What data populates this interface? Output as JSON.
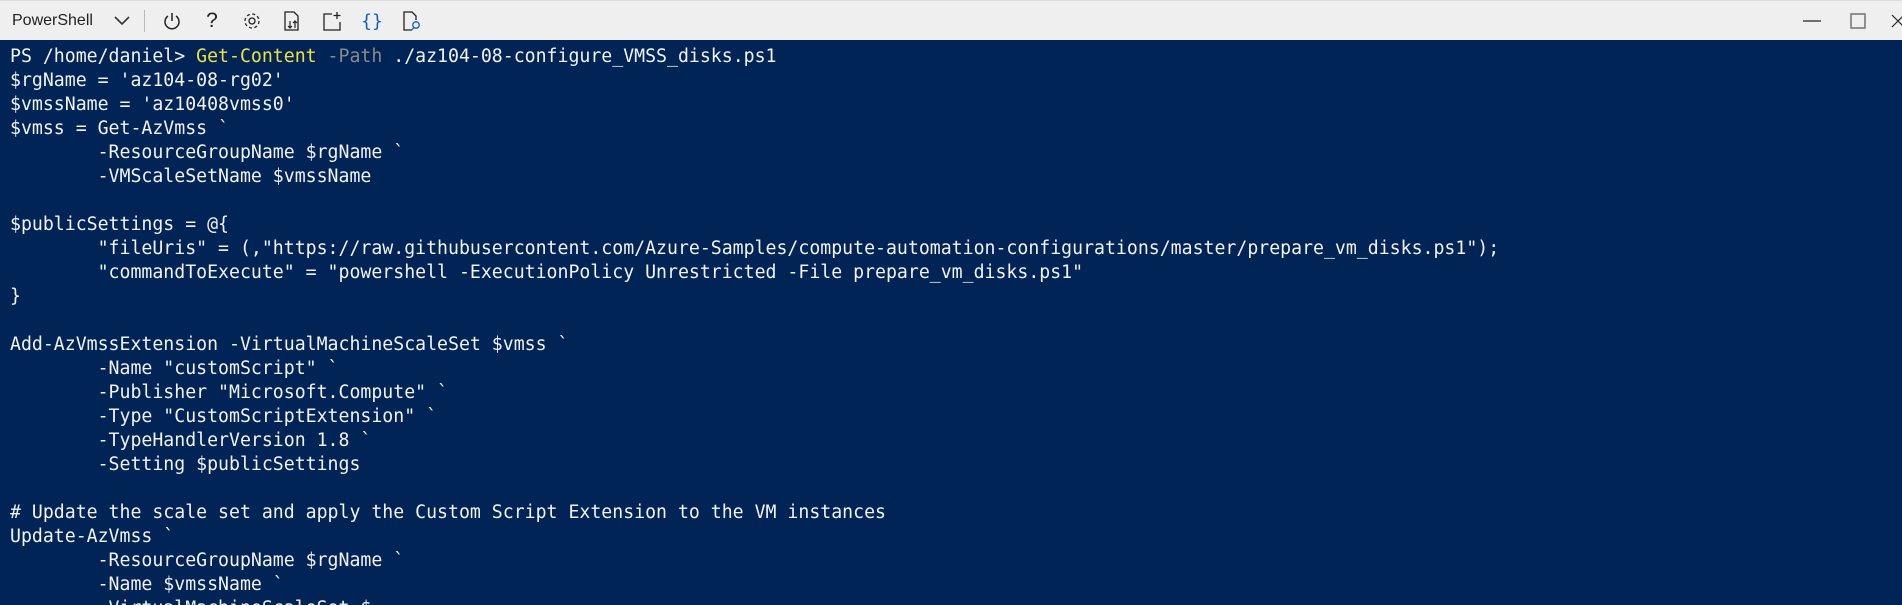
{
  "toolbar": {
    "shell_selector": "PowerShell",
    "icons": [
      "chevron-down-icon",
      "power-icon",
      "help-icon",
      "gear-icon",
      "upload-download-icon",
      "new-session-icon",
      "braces-icon",
      "web-preview-icon"
    ],
    "window_controls": [
      "minimize-icon",
      "maximize-icon",
      "close-icon"
    ]
  },
  "colors": {
    "terminal_bg": "#012456",
    "toolbar_bg": "#efefef",
    "command": "#f0e040",
    "parameter": "#8a8a8a",
    "text": "#f2f2f2"
  },
  "terminal": {
    "lines": [
      [
        {
          "t": "PS /home/daniel> ",
          "c": "white"
        },
        {
          "t": "Get-Content",
          "c": "yellow"
        },
        {
          "t": " -Path",
          "c": "gray"
        },
        {
          "t": " ./az104-08-configure_VMSS_disks.ps1",
          "c": "white"
        }
      ],
      [
        {
          "t": "$rgName = 'az104-08-rg02'",
          "c": "white"
        }
      ],
      [
        {
          "t": "$vmssName = 'az10408vmss0'",
          "c": "white"
        }
      ],
      [
        {
          "t": "$vmss = Get-AzVmss `",
          "c": "white"
        }
      ],
      [
        {
          "t": "        -ResourceGroupName $rgName `",
          "c": "white"
        }
      ],
      [
        {
          "t": "        -VMScaleSetName $vmssName",
          "c": "white"
        }
      ],
      [
        {
          "t": "",
          "c": "white"
        }
      ],
      [
        {
          "t": "$publicSettings = @{",
          "c": "white"
        }
      ],
      [
        {
          "t": "        \"fileUris\" = (,\"https://raw.githubusercontent.com/Azure-Samples/compute-automation-configurations/master/prepare_vm_disks.ps1\");",
          "c": "white"
        }
      ],
      [
        {
          "t": "        \"commandToExecute\" = \"powershell -ExecutionPolicy Unrestricted -File prepare_vm_disks.ps1\"",
          "c": "white"
        }
      ],
      [
        {
          "t": "}",
          "c": "white"
        }
      ],
      [
        {
          "t": "",
          "c": "white"
        }
      ],
      [
        {
          "t": "Add-AzVmssExtension -VirtualMachineScaleSet $vmss `",
          "c": "white"
        }
      ],
      [
        {
          "t": "        -Name \"customScript\" `",
          "c": "white"
        }
      ],
      [
        {
          "t": "        -Publisher \"Microsoft.Compute\" `",
          "c": "white"
        }
      ],
      [
        {
          "t": "        -Type \"CustomScriptExtension\" `",
          "c": "white"
        }
      ],
      [
        {
          "t": "        -TypeHandlerVersion 1.8 `",
          "c": "white"
        }
      ],
      [
        {
          "t": "        -Setting $publicSettings",
          "c": "white"
        }
      ],
      [
        {
          "t": "",
          "c": "white"
        }
      ],
      [
        {
          "t": "# Update the scale set and apply the Custom Script Extension to the VM instances",
          "c": "white"
        }
      ],
      [
        {
          "t": "Update-AzVmss `",
          "c": "white"
        }
      ],
      [
        {
          "t": "        -ResourceGroupName $rgName `",
          "c": "white"
        }
      ],
      [
        {
          "t": "        -Name $vmssName `",
          "c": "white"
        }
      ],
      [
        {
          "t": "        -VirtualMachineScaleSet $",
          "c": "white"
        }
      ]
    ]
  }
}
